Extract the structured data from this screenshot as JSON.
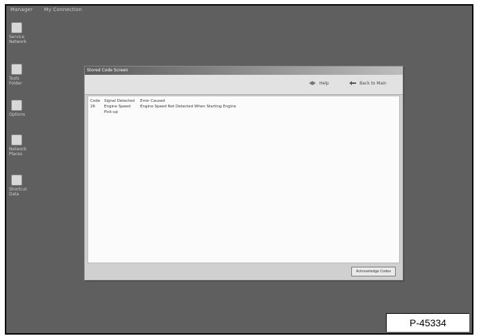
{
  "figure_label": "P-45334",
  "desktop": {
    "top_items": [
      "Manager",
      "My Connection"
    ],
    "icons": [
      {
        "name": "my-computer",
        "label": "Service\nNetwork"
      },
      {
        "name": "recycle-bin",
        "label": "Tools\nFolder"
      },
      {
        "name": "folder",
        "label": "Options"
      },
      {
        "name": "network",
        "label": "Network\nPlaces"
      },
      {
        "name": "document",
        "label": "Shortcut\nData"
      }
    ]
  },
  "window": {
    "title": "Stored Code Screen",
    "toolbar": {
      "help_label": "Help",
      "back_label": "Back to Main"
    },
    "table": {
      "columns": [
        "Code",
        "Signal Detected",
        "Error Caused"
      ],
      "rows": [
        {
          "code": "26",
          "signal": "Engine Speed Pick-up",
          "error": "Engine Speed Not Detected When Starting Engine"
        }
      ]
    },
    "acknowledge_button": "Acknowledge Codes"
  }
}
